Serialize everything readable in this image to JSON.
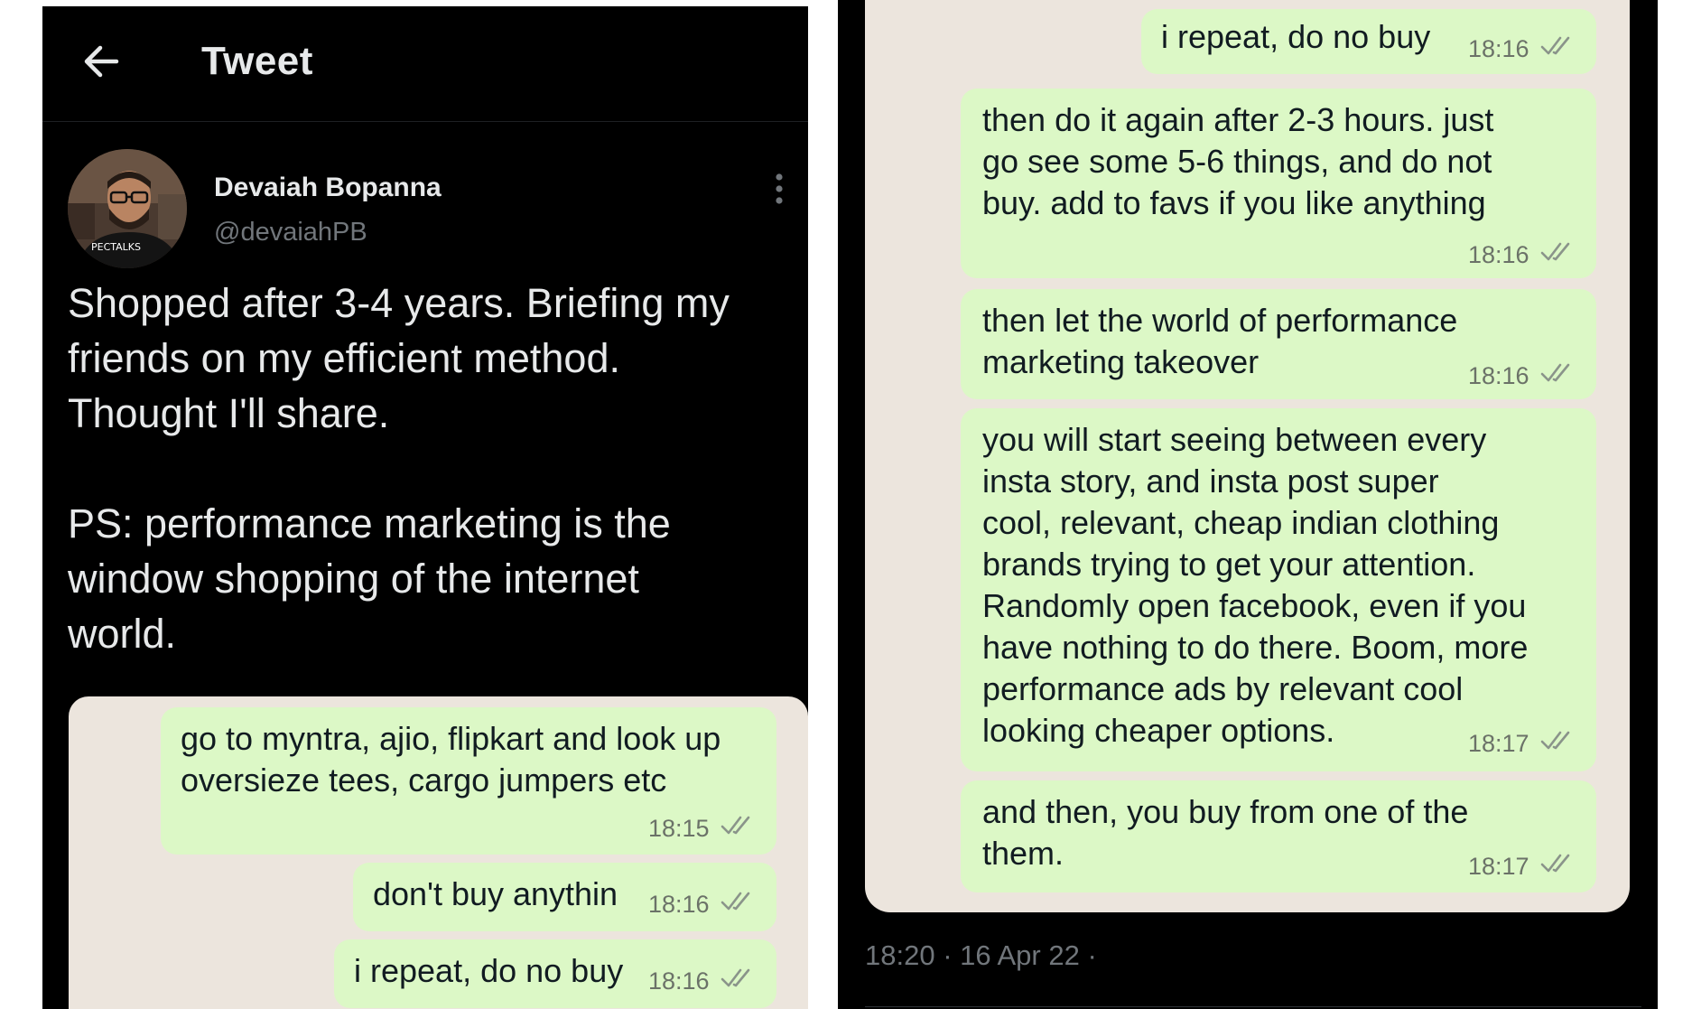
{
  "tweet": {
    "header_title": "Tweet",
    "author_name": "Devaiah Bopanna",
    "author_handle": "@devaiahPB",
    "avatar_shirt_text": "PECTALKS",
    "text_para1_lines": [
      "Shopped after 3-4 years. Briefing my",
      "friends on my efficient method.",
      "Thought I'll share."
    ],
    "text_para2_lines": [
      "PS: performance marketing is the",
      "window shopping of the internet",
      "world."
    ],
    "footer_meta": "18:20 · 16 Apr 22 ·"
  },
  "chat_left": {
    "messages": [
      {
        "lines": [
          "go to myntra, ajio, flipkart and look up",
          "oversieze tees, cargo jumpers etc"
        ],
        "time": "18:15"
      },
      {
        "lines": [
          "don't buy anythin"
        ],
        "time": "18:16"
      },
      {
        "lines": [
          "i repeat, do no buy"
        ],
        "time": "18:16"
      }
    ]
  },
  "chat_right": {
    "messages": [
      {
        "lines": [
          "i repeat, do no buy"
        ],
        "time": "18:16"
      },
      {
        "lines": [
          "then do it again after 2-3 hours. just",
          "go see some 5-6 things, and do not",
          "buy. add to favs if you like anything"
        ],
        "time": "18:16"
      },
      {
        "lines": [
          "then let the world of performance",
          "marketing takeover"
        ],
        "time": "18:16"
      },
      {
        "lines": [
          "you will start seeing between every",
          "insta story, and insta post super",
          "cool, relevant, cheap indian clothing",
          "brands trying to get your attention.",
          "Randomly open facebook, even if you",
          "have nothing to do there. Boom, more",
          "performance ads by relevant cool",
          "looking cheaper options."
        ],
        "time": "18:17"
      },
      {
        "lines": [
          "and then, you buy from one of the",
          "them."
        ],
        "time": "18:17"
      }
    ]
  },
  "colors": {
    "twitter_bg": "#000000",
    "chat_wallpaper": "#ece5dd",
    "outgoing_bubble": "#dcf8c6",
    "read_tick": "#8a948a"
  },
  "icons": [
    "back-arrow-icon",
    "more-vertical-icon",
    "double-check-icon"
  ]
}
